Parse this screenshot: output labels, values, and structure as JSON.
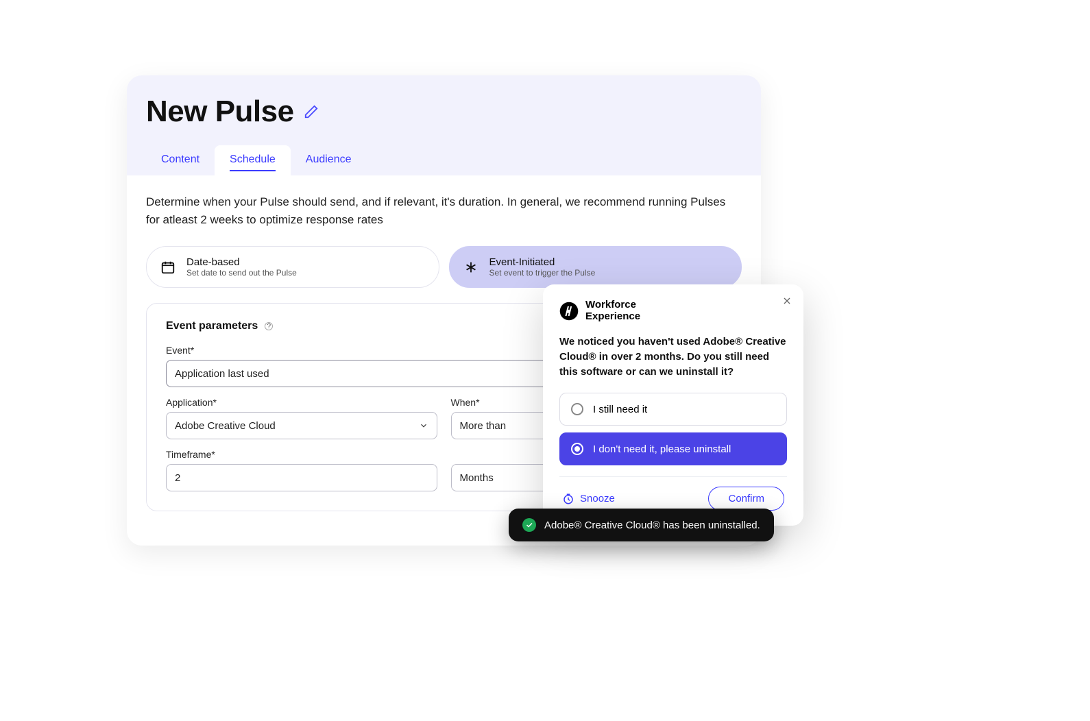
{
  "header": {
    "title": "New Pulse",
    "tabs": [
      {
        "label": "Content",
        "active": false
      },
      {
        "label": "Schedule",
        "active": true
      },
      {
        "label": "Audience",
        "active": false
      }
    ]
  },
  "description": "Determine when your Pulse should send, and if relevant, it's duration. In general, we recommend running Pulses for atleast 2 weeks to optimize response rates",
  "modes": {
    "date": {
      "title": "Date-based",
      "subtitle": "Set date to send out the Pulse",
      "selected": false
    },
    "event": {
      "title": "Event-Initiated",
      "subtitle": "Set event to trigger the Pulse",
      "selected": true
    }
  },
  "params": {
    "section_title": "Event parameters",
    "event": {
      "label": "Event*",
      "value": "Application last used"
    },
    "application": {
      "label": "Application*",
      "value": "Adobe Creative Cloud"
    },
    "when": {
      "label": "When*",
      "value": "More than"
    },
    "timeframe": {
      "label": "Timeframe*",
      "value": "2"
    },
    "unit": {
      "label": "",
      "value": "Months"
    }
  },
  "popup": {
    "brand_line1": "Workforce",
    "brand_line2": "Experience",
    "message": "We noticed you haven't used Adobe® Creative Cloud® in over 2 months. Do you still need this software or can we uninstall it?",
    "options": [
      {
        "label": "I still need it",
        "selected": false
      },
      {
        "label": "I don't need it, please uninstall",
        "selected": true
      }
    ],
    "snooze_label": "Snooze",
    "confirm_label": "Confirm"
  },
  "toast": {
    "message": "Adobe® Creative Cloud® has been uninstalled."
  }
}
